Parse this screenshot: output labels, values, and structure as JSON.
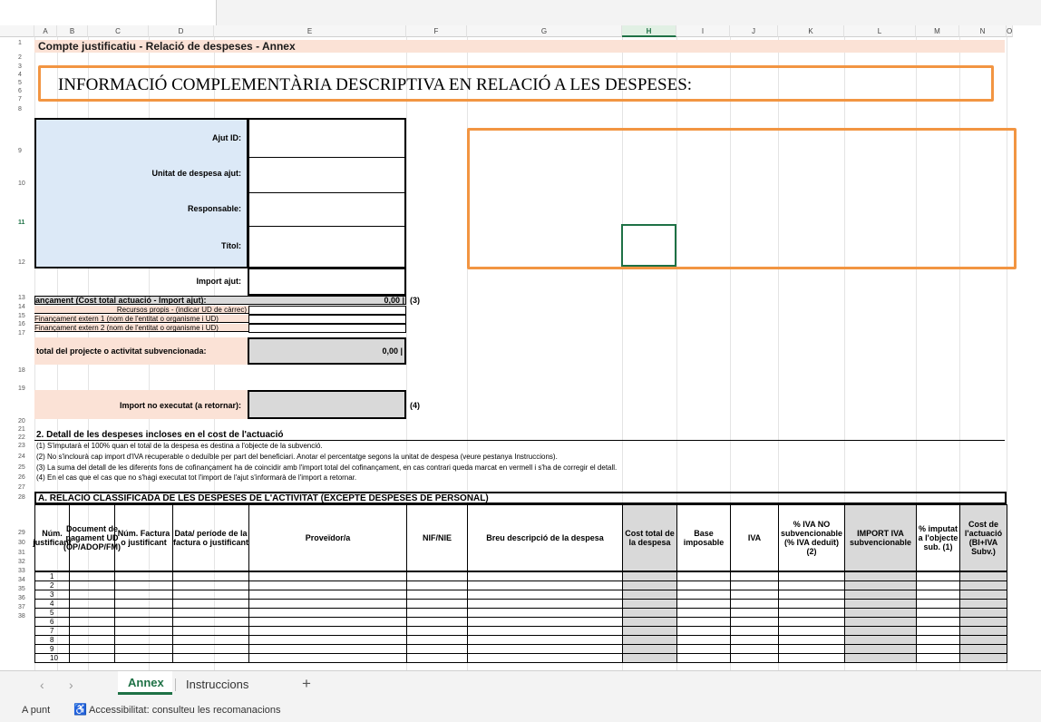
{
  "columns": [
    "A",
    "B",
    "C",
    "D",
    "E",
    "F",
    "G",
    "H",
    "I",
    "J",
    "K",
    "L",
    "M",
    "N",
    "O"
  ],
  "title": "Compte justificatiu - Relació de despeses - Annex",
  "banner": "INFORMACIÓ COMPLEMENTÀRIA DESCRIPTIVA EN RELACIÓ A LES DESPESES:",
  "form": {
    "ajut_id": "Ajut ID:",
    "unitat": "Unitat de despesa ajut:",
    "responsable": "Responsable:",
    "titol": "Títol:",
    "import_ajut": "Import ajut:",
    "financament": "ançament (Cost total actuació - Import ajut):",
    "financament_value": "0,00 |",
    "note3": "(3)",
    "recursos": "Recursos propis - (indicar UD de càrrec)",
    "extern1": "Finançament extern 1 (nom de l'entitat o organisme i UD)",
    "extern2": "Finançament extern 2 (nom de l'entitat o organisme i UD)",
    "total": "total del projecte o activitat subvencionada:",
    "total_value": "0,00 |",
    "no_executat": "Import no executat (a retornar):",
    "note4": "(4)"
  },
  "section2": {
    "title": "2. Detall de les despeses incloses en el cost de l'actuació",
    "notes": [
      "(1) S'imputarà el 100% quan el total de la despesa es destina a l'objecte de la subvenció.",
      "(2) No s'inclourà cap import d'IVA recuperable o deduïble per part del beneficiari. Anotar el percentatge segons la unitat de despesa (veure pestanya Instruccions).",
      "(3) La suma del detall de les diferents fons de cofinançament ha de coincidir amb l'import total del cofinançament, en cas contrari queda marcat en vermell i s'ha de corregir el detall.",
      "(4) En el cas que el cas que no s'hagi executat tot l'import de l'ajut s'informarà de l'import a retornar."
    ]
  },
  "tableA": {
    "title": "A. RELACIÓ CLASSIFICADA DE LES DESPESES DE L'ACTIVITAT (EXCEPTE DESPESES DE PERSONAL)",
    "headers": [
      "Núm. justificant",
      "Document de pagament UD (OP/ADOP/FM)",
      "Núm. Factura o justificant",
      "Data/ període de la factura o justificant",
      "Proveïdor/a",
      "NIF/NIE",
      "Breu descripció de la despesa",
      "Cost total de la despesa",
      "Base imposable",
      "IVA",
      "% IVA NO subvencionable (% IVA deduït) (2)",
      "IMPORT IVA subvencionable",
      "% imputat a l'objecte sub. (1)",
      "Cost de l'actuació (BI+IVA Subv.)"
    ],
    "rows": [
      "1",
      "2",
      "3",
      "4",
      "5",
      "6",
      "7",
      "8",
      "9",
      "10"
    ]
  },
  "row_numbers": [
    "1",
    "2",
    "3",
    "4",
    "5",
    "6",
    "7",
    "8",
    "9",
    "10",
    "11",
    "12",
    "13",
    "14",
    "15",
    "16",
    "17",
    "18",
    "19",
    "20",
    "21",
    "22",
    "23",
    "24",
    "25",
    "26",
    "27",
    "28",
    "29",
    "30",
    "31",
    "32",
    "33",
    "34",
    "35",
    "36",
    "37",
    "38"
  ],
  "sheet_tabs": {
    "tabs": [
      "Annex",
      "Instruccions"
    ],
    "active": "Annex",
    "add": "+"
  },
  "status": {
    "mode": "A punt",
    "accessibility": "Accessibilitat: consulteu les recomanacions"
  }
}
